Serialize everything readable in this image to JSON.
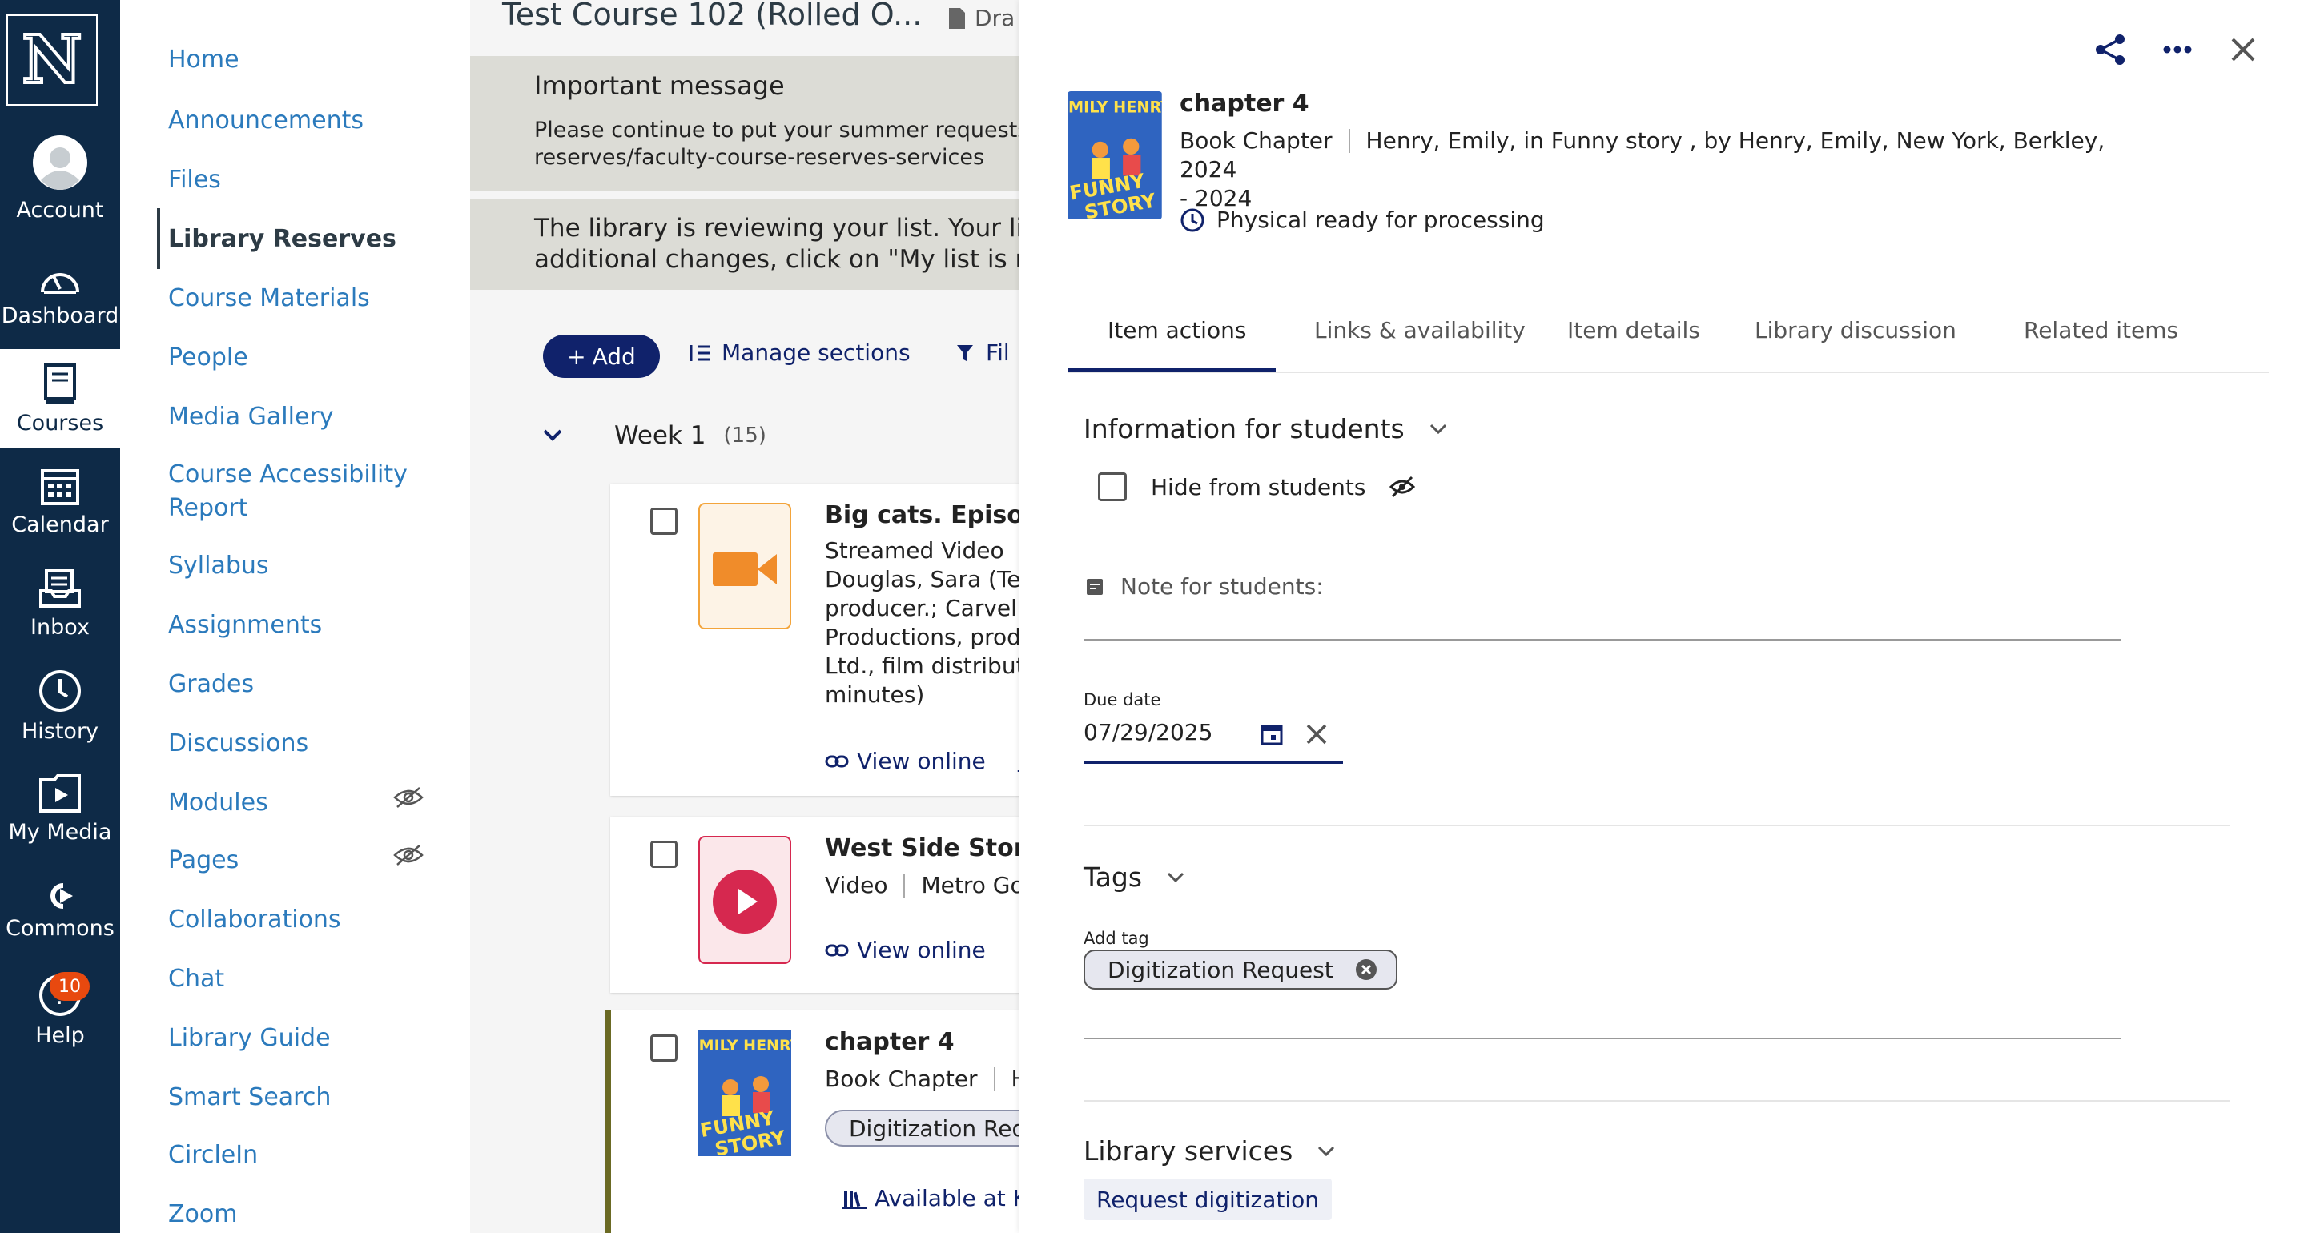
{
  "global_nav": {
    "logo_letter": "N",
    "items": [
      {
        "label": "Account",
        "icon": "account-icon"
      },
      {
        "label": "Dashboard",
        "icon": "dashboard-icon"
      },
      {
        "label": "Courses",
        "icon": "courses-icon"
      },
      {
        "label": "Calendar",
        "icon": "calendar-icon"
      },
      {
        "label": "Inbox",
        "icon": "inbox-icon"
      },
      {
        "label": "History",
        "icon": "history-icon"
      },
      {
        "label": "My Media",
        "icon": "media-icon"
      },
      {
        "label": "Commons",
        "icon": "commons-icon"
      },
      {
        "label": "Help",
        "icon": "help-icon",
        "badge": "10"
      }
    ]
  },
  "course_nav": {
    "items": [
      "Home",
      "Announcements",
      "Files",
      "Library Reserves",
      "Course Materials",
      "People",
      "Media Gallery",
      "Course Accessibility",
      "Report",
      "Syllabus",
      "Assignments",
      "Grades",
      "Discussions",
      "Modules",
      "Pages",
      "Collaborations",
      "Chat",
      "Library Guide",
      "Smart Search",
      "CircleIn",
      "Zoom"
    ],
    "active": "Library Reserves"
  },
  "main": {
    "course_title": "Test Course 102 (Rolled O...",
    "draft_label": "Dra",
    "important_heading": "Important message",
    "important_line1": "Please continue to put your summer requests",
    "important_line2": "reserves/faculty-course-reserves-services",
    "review_line1": "The library is reviewing your list. Your list",
    "review_line2": "additional changes, click on \"My list is rea",
    "add_label": "Add",
    "manage_label": "Manage sections",
    "filter_label": "Fil",
    "week_label": "Week 1",
    "week_count": "(15)",
    "cards": [
      {
        "title": "Big cats. Episode",
        "meta": [
          "Streamed Video",
          "Douglas, Sara (Tele",
          "producer.; Carvel, E",
          "Productions, produ",
          "Ltd., film distributo",
          "minutes)"
        ],
        "link": "View online",
        "link2": "M"
      },
      {
        "title": "West Side Story",
        "meta_type": "Video",
        "meta_rest": "Metro Gol",
        "link": "View online"
      },
      {
        "title": "chapter 4",
        "meta_type": "Book Chapter",
        "meta_rest": "He",
        "tag": "Digitization Requ",
        "avail": "Available at Kr"
      }
    ]
  },
  "panel": {
    "title": "chapter 4",
    "type": "Book Chapter",
    "citation_line1": "Henry, Emily, in Funny story , by Henry, Emily, New York, Berkley, 2024",
    "citation_line2": "- 2024",
    "status": "Physical ready for processing",
    "cover_author": "EMILY HENRY",
    "cover_title_1": "FUNNY",
    "cover_title_2": "STORY",
    "tabs": [
      "Item actions",
      "Links & availability",
      "Item details",
      "Library discussion",
      "Related items"
    ],
    "info_heading": "Information for students",
    "hide_label": "Hide from students",
    "note_label": "Note for students:",
    "due_label": "Due date",
    "due_value": "07/29/2025",
    "tags_heading": "Tags",
    "add_tag_label": "Add tag",
    "tag_value": "Digitization Request",
    "services_heading": "Library services",
    "request_btn": "Request digitization"
  },
  "colors": {
    "nav_bg": "#0e2a47",
    "link": "#2b7abc",
    "primary": "#10226b",
    "badge": "#e8490f"
  }
}
